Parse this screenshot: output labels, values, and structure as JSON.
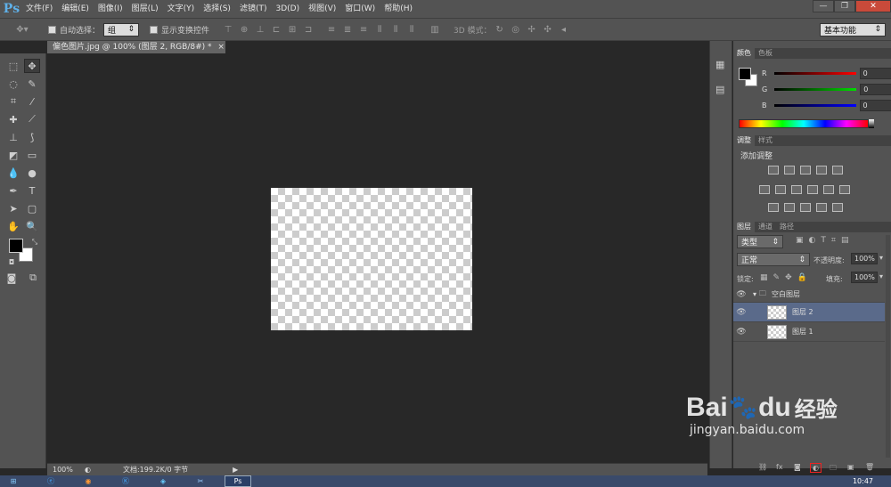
{
  "app": {
    "logo": "Ps"
  },
  "menu": [
    "文件(F)",
    "编辑(E)",
    "图像(I)",
    "图层(L)",
    "文字(Y)",
    "选择(S)",
    "滤镜(T)",
    "3D(D)",
    "视图(V)",
    "窗口(W)",
    "帮助(H)"
  ],
  "window_controls": {
    "min": "—",
    "max": "❐",
    "close": "✕"
  },
  "options": {
    "auto_select_label": "自动选择：",
    "auto_select_value": "组",
    "show_transform_label": "显示变换控件",
    "mode_3d_label": "3D 模式：",
    "workspace": "基本功能"
  },
  "document": {
    "tab_title": "偏色图片.jpg @ 100% (图层 2, RGB/8#) *"
  },
  "status": {
    "zoom": "100%",
    "doc_info": "文档:199.2K/0 字节"
  },
  "color_panel": {
    "tabs": [
      "颜色",
      "色板"
    ],
    "r_label": "R",
    "g_label": "G",
    "b_label": "B",
    "r_value": "0",
    "g_value": "0",
    "b_value": "0"
  },
  "adjust_panel": {
    "tabs": [
      "调整",
      "样式"
    ],
    "title": "添加调整"
  },
  "layers_panel": {
    "tabs": [
      "图层",
      "通道",
      "路径"
    ],
    "filter_kind": "类型",
    "blend_mode": "正常",
    "opacity_label": "不透明度:",
    "opacity_value": "100%",
    "lock_label": "锁定:",
    "fill_label": "填充:",
    "fill_value": "100%",
    "group_name": "空白图层",
    "layers": [
      {
        "name": "图层 2",
        "selected": true
      },
      {
        "name": "图层 1",
        "selected": false
      }
    ]
  },
  "taskbar": {
    "time": "10:47"
  },
  "watermark": {
    "brand": "Bai",
    "brand2": "du",
    "suffix": "经验",
    "url": "jingyan.baidu.com"
  },
  "colors": {
    "accent": "#5fb0e8",
    "selected_layer": "#5a6a8a",
    "panel_bg": "#535353"
  }
}
